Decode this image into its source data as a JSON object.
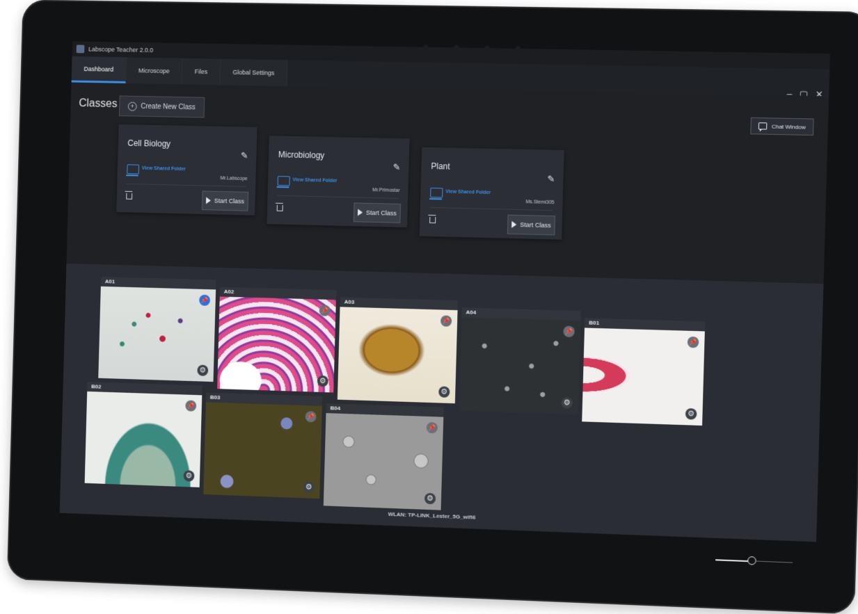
{
  "window": {
    "title": "Labscope Teacher 2.0.0",
    "controls": [
      "–",
      "▢",
      "✕"
    ]
  },
  "tabs": [
    {
      "label": "Dashboard",
      "active": true
    },
    {
      "label": "Microscope",
      "active": false
    },
    {
      "label": "Files",
      "active": false
    },
    {
      "label": "Global Settings",
      "active": false
    }
  ],
  "classes": {
    "heading": "Classes",
    "create_button": "Create New Class",
    "chat_button": "Chat Window",
    "cards": [
      {
        "name": "Cell Biology",
        "shared_folder": "View Shared Folder",
        "teacher": "Mr.Labscope",
        "start_button": "Start Class"
      },
      {
        "name": "Microbiology",
        "shared_folder": "View Shared Folder",
        "teacher": "Mr.Primostar",
        "start_button": "Start Class"
      },
      {
        "name": "Plant",
        "shared_folder": "View Shared Folder",
        "teacher": "Ms.Stemi305",
        "start_button": "Start Class"
      }
    ]
  },
  "microscopes": [
    {
      "id": "A01",
      "pinned": true
    },
    {
      "id": "A02",
      "pinned": false
    },
    {
      "id": "A03",
      "pinned": false
    },
    {
      "id": "A04",
      "pinned": false
    },
    {
      "id": "B01",
      "pinned": false
    },
    {
      "id": "B02",
      "pinned": false
    },
    {
      "id": "B03",
      "pinned": false
    },
    {
      "id": "B04",
      "pinned": false
    }
  ],
  "status": {
    "wlan": "WLAN: TP-LINK_Lester_5G_wifi6"
  },
  "colors": {
    "accent": "#3a8ee6",
    "pin_active": "#2f6fd6"
  }
}
